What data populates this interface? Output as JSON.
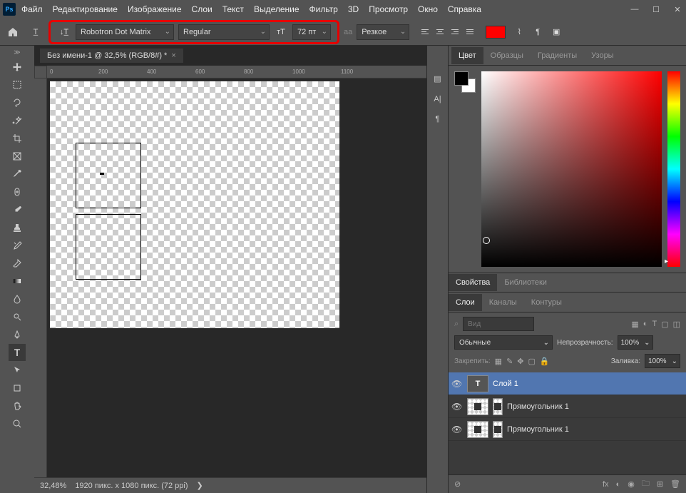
{
  "app": {
    "logo": "Ps"
  },
  "menu": [
    "Файл",
    "Редактирование",
    "Изображение",
    "Слои",
    "Текст",
    "Выделение",
    "Фильтр",
    "3D",
    "Просмотр",
    "Окно",
    "Справка"
  ],
  "options": {
    "font_family": "Robotron Dot Matrix",
    "font_style": "Regular",
    "font_size": "72 пт",
    "aa": "Резкое",
    "aa_label": "aа"
  },
  "doc": {
    "tab_title": "Без имени-1 @ 32,5% (RGB/8#) *",
    "zoom": "32,48%",
    "info": "1920 пикс. x 1080 пикс. (72 ppi)"
  },
  "ruler_marks": [
    "0",
    "200",
    "400",
    "600",
    "800",
    "1000",
    "1100"
  ],
  "panels": {
    "color_tabs": [
      "Цвет",
      "Образцы",
      "Градиенты",
      "Узоры"
    ],
    "props_tabs": [
      "Свойства",
      "Библиотеки"
    ],
    "layers_tabs": [
      "Слои",
      "Каналы",
      "Контуры"
    ],
    "layer_search_placeholder": "Вид",
    "blend_mode": "Обычные",
    "opacity_label": "Непрозрачность:",
    "opacity": "100%",
    "lock_label": "Закрепить:",
    "fill_label": "Заливка:",
    "fill": "100%"
  },
  "layers": [
    {
      "name": "Слой 1",
      "type": "text",
      "selected": true
    },
    {
      "name": "Прямоугольник 1",
      "type": "shape",
      "selected": false
    },
    {
      "name": "Прямоугольник 1",
      "type": "shape",
      "selected": false
    }
  ]
}
